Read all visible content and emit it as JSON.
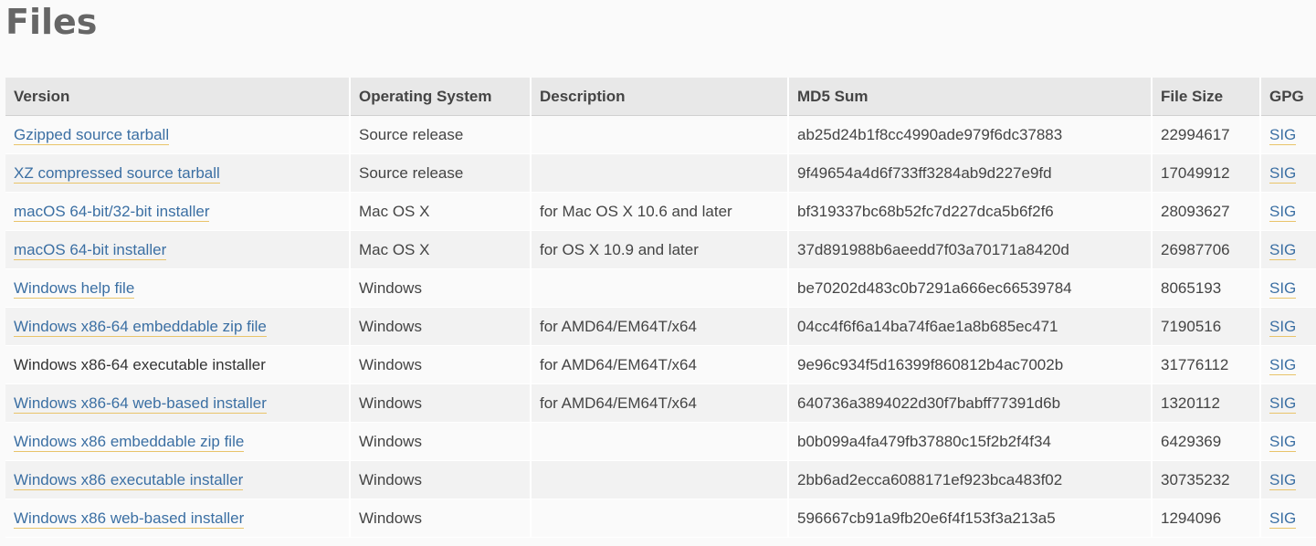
{
  "page": {
    "title": "Files"
  },
  "table": {
    "headers": [
      "Version",
      "Operating System",
      "Description",
      "MD5 Sum",
      "File Size",
      "GPG"
    ],
    "rows": [
      {
        "version": "Gzipped source tarball",
        "os": "Source release",
        "description": "",
        "md5": "ab25d24b1f8cc4990ade979f6dc37883",
        "size": "22994617",
        "gpg": "SIG"
      },
      {
        "version": "XZ compressed source tarball",
        "os": "Source release",
        "description": "",
        "md5": "9f49654a4d6f733ff3284ab9d227e9fd",
        "size": "17049912",
        "gpg": "SIG"
      },
      {
        "version": "macOS 64-bit/32-bit installer",
        "os": "Mac OS X",
        "description": "for Mac OS X 10.6 and later",
        "md5": "bf319337bc68b52fc7d227dca5b6f2f6",
        "size": "28093627",
        "gpg": "SIG"
      },
      {
        "version": "macOS 64-bit installer",
        "os": "Mac OS X",
        "description": "for OS X 10.9 and later",
        "md5": "37d891988b6aeedd7f03a70171a8420d",
        "size": "26987706",
        "gpg": "SIG"
      },
      {
        "version": "Windows help file",
        "os": "Windows",
        "description": "",
        "md5": "be70202d483c0b7291a666ec66539784",
        "size": "8065193",
        "gpg": "SIG"
      },
      {
        "version": "Windows x86-64 embeddable zip file",
        "os": "Windows",
        "description": "for AMD64/EM64T/x64",
        "md5": "04cc4f6f6a14ba74f6ae1a8b685ec471",
        "size": "7190516",
        "gpg": "SIG"
      },
      {
        "version": "Windows x86-64 executable installer",
        "os": "Windows",
        "description": "for AMD64/EM64T/x64",
        "md5": "9e96c934f5d16399f860812b4ac7002b",
        "size": "31776112",
        "gpg": "SIG"
      },
      {
        "version": "Windows x86-64 web-based installer",
        "os": "Windows",
        "description": "for AMD64/EM64T/x64",
        "md5": "640736a3894022d30f7babff77391d6b",
        "size": "1320112",
        "gpg": "SIG"
      },
      {
        "version": "Windows x86 embeddable zip file",
        "os": "Windows",
        "description": "",
        "md5": "b0b099a4fa479fb37880c15f2b2f4f34",
        "size": "6429369",
        "gpg": "SIG"
      },
      {
        "version": "Windows x86 executable installer",
        "os": "Windows",
        "description": "",
        "md5": "2bb6ad2ecca6088171ef923bca483f02",
        "size": "30735232",
        "gpg": "SIG"
      },
      {
        "version": "Windows x86 web-based installer",
        "os": "Windows",
        "description": "",
        "md5": "596667cb91a9fb20e6f4f153f3a213a5",
        "size": "1294096",
        "gpg": "SIG"
      }
    ]
  },
  "colors": {
    "link": "#3b6fa3",
    "link_underline": "#e9c46a",
    "header_bg": "#e8e8e8",
    "title": "#666666"
  }
}
